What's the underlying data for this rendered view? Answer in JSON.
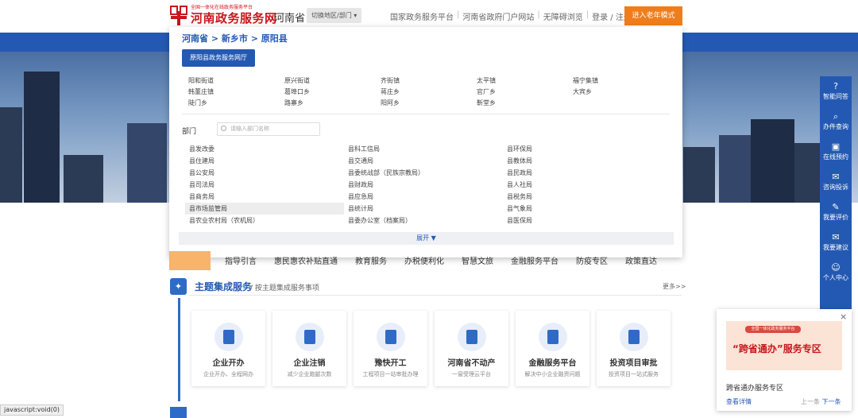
{
  "header": {
    "logo_small": "全国一体化在线政务服务平台",
    "logo_big": "河南政务服务网",
    "province": "河南省",
    "switch_label": "切换地区/部门 ▾",
    "links": [
      "国家政务服务平台",
      "河南省政府门户网站",
      "无障碍浏览",
      "登录 / 注册"
    ],
    "elder_mode": "进入老年模式"
  },
  "dropdown": {
    "breadcrumb": "河南省 > 新乡市 > 原阳县",
    "hall_button": "原阳县政务服务网厅",
    "towns": [
      "阳和街道",
      "原兴街道",
      "齐街镇",
      "太平镇",
      "福宁集镇",
      "韩董庄镇",
      "葛埠口乡",
      "蒋庄乡",
      "官厂乡",
      "大宾乡",
      "陡门乡",
      "路寨乡",
      "阳阿乡",
      "靳堂乡"
    ],
    "dept_label": "部门",
    "dept_search_placeholder": "请输入部门名称",
    "departments": [
      "县发改委",
      "县科工信局",
      "县环保局",
      "县住建局",
      "县交通局",
      "县教体局",
      "县公安局",
      "县委统战部（民族宗教局）",
      "县民政局",
      "县司法局",
      "县财政局",
      "县人社局",
      "县商务局",
      "县应急局",
      "县税务局",
      "县市场监管局",
      "县统计局",
      "县气象局",
      "县农业农村局（农机局）",
      "县委办公室（档案局）",
      "县医保局"
    ],
    "highlighted_index": 15,
    "expand_label": "展开 ▼"
  },
  "nav": {
    "items": [
      "指导引言",
      "惠民惠农补贴直通",
      "教育服务",
      "办税便利化",
      "智慧文旅",
      "金融服务平台",
      "防疫专区",
      "政策直达"
    ]
  },
  "themes": {
    "title": "主题集成服务",
    "subtitle": "/ 按主题集成服务事项",
    "more": "更多>>",
    "cards": [
      {
        "title": "企业开办",
        "sub": "企业开办、全程网办"
      },
      {
        "title": "企业注销",
        "sub": "减少企业跑腿次数"
      },
      {
        "title": "豫快开工",
        "sub": "工程项目一站审批办理"
      },
      {
        "title": "河南省不动产",
        "sub": "一窗受理云平台"
      },
      {
        "title": "金融服务平台",
        "sub": "解决中小企业融资问题"
      },
      {
        "title": "投资项目审批",
        "sub": "投资项目一站式服务"
      }
    ]
  },
  "sidebar": {
    "items": [
      {
        "label": "智能问答",
        "icon": "?"
      },
      {
        "label": "办件查询",
        "icon": "⌕"
      },
      {
        "label": "在线预约",
        "icon": "▣"
      },
      {
        "label": "咨询投诉",
        "icon": "✉"
      },
      {
        "label": "我要评价",
        "icon": "✎"
      },
      {
        "label": "我要建议",
        "icon": "✉"
      },
      {
        "label": "个人中心",
        "icon": "☺"
      }
    ]
  },
  "promo": {
    "close": "×",
    "img_small": "全国一体化政务服务平台",
    "img_big": "“跨省通办”服务专区",
    "title": "跨省通办服务专区",
    "link": "查看详情",
    "prev": "上一条",
    "next": "下一条"
  },
  "status_bar": "javascript:void(0)"
}
